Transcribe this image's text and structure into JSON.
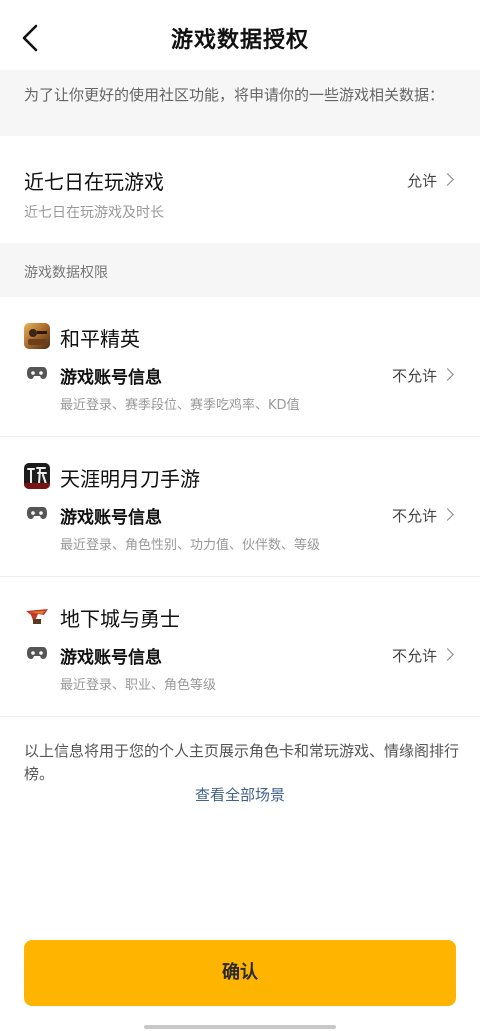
{
  "header": {
    "back_icon": "chevron-left-icon",
    "title": "游戏数据授权"
  },
  "intro": {
    "text": "为了让你更好的使用社区功能，将申请你的一些游戏相关数据："
  },
  "recent_games": {
    "title": "近七日在玩游戏",
    "subtitle": "近七日在玩游戏及时长",
    "permission": "允许"
  },
  "section": {
    "title": "游戏数据权限"
  },
  "games": [
    {
      "name": "和平精英",
      "icon": "game-icon-peace-elite",
      "account_label": "游戏账号信息",
      "account_desc": "最近登录、赛季段位、赛季吃鸡率、KD值",
      "permission": "不允许"
    },
    {
      "name": "天涯明月刀手游",
      "icon": "game-icon-tianya",
      "account_label": "游戏账号信息",
      "account_desc": "最近登录、角色性别、功力值、伙伴数、等级",
      "permission": "不允许"
    },
    {
      "name": "地下城与勇士",
      "icon": "game-icon-dnf",
      "account_label": "游戏账号信息",
      "account_desc": "最近登录、职业、角色等级",
      "permission": "不允许"
    }
  ],
  "note": {
    "text": "以上信息将用于您的个人主页展示角色卡和常玩游戏、情缘阁排行榜。",
    "link": "查看全部场景"
  },
  "confirm": {
    "label": "确认",
    "color": "#ffb400"
  },
  "colors": {
    "accent": "#ffb400",
    "link": "#40628c",
    "section_bg": "#f6f6f6"
  }
}
